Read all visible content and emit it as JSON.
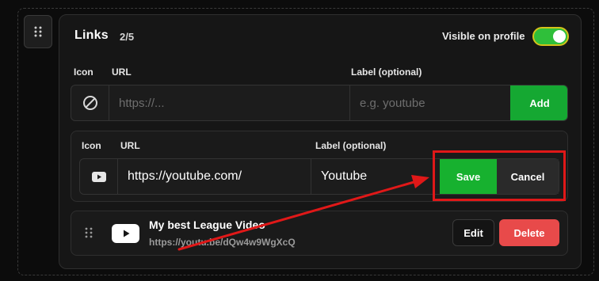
{
  "section": {
    "title": "Links",
    "count": "2/5",
    "visibility_label": "Visible on profile",
    "visibility_on": true
  },
  "new_link_form": {
    "headers": {
      "icon": "Icon",
      "url": "URL",
      "label": "Label (optional)"
    },
    "icon": "ban-icon",
    "url_placeholder": "https://...",
    "label_placeholder": "e.g. youtube",
    "add_label": "Add"
  },
  "edit_link_form": {
    "headers": {
      "icon": "Icon",
      "url": "URL",
      "label": "Label (optional)"
    },
    "icon": "youtube-icon",
    "url_value": "https://youtube.com/",
    "label_value": "Youtube",
    "save_label": "Save",
    "cancel_label": "Cancel"
  },
  "links": [
    {
      "title": "My best League Video",
      "url": "https://youtu.be/dQw4w9WgXcQ",
      "icon": "youtube-icon",
      "edit_label": "Edit",
      "delete_label": "Delete"
    }
  ],
  "colors": {
    "accent_green": "#17b12f",
    "delete_red": "#e84a4a",
    "annotation_red": "#e01818",
    "toggle_border": "#d4c21a"
  }
}
